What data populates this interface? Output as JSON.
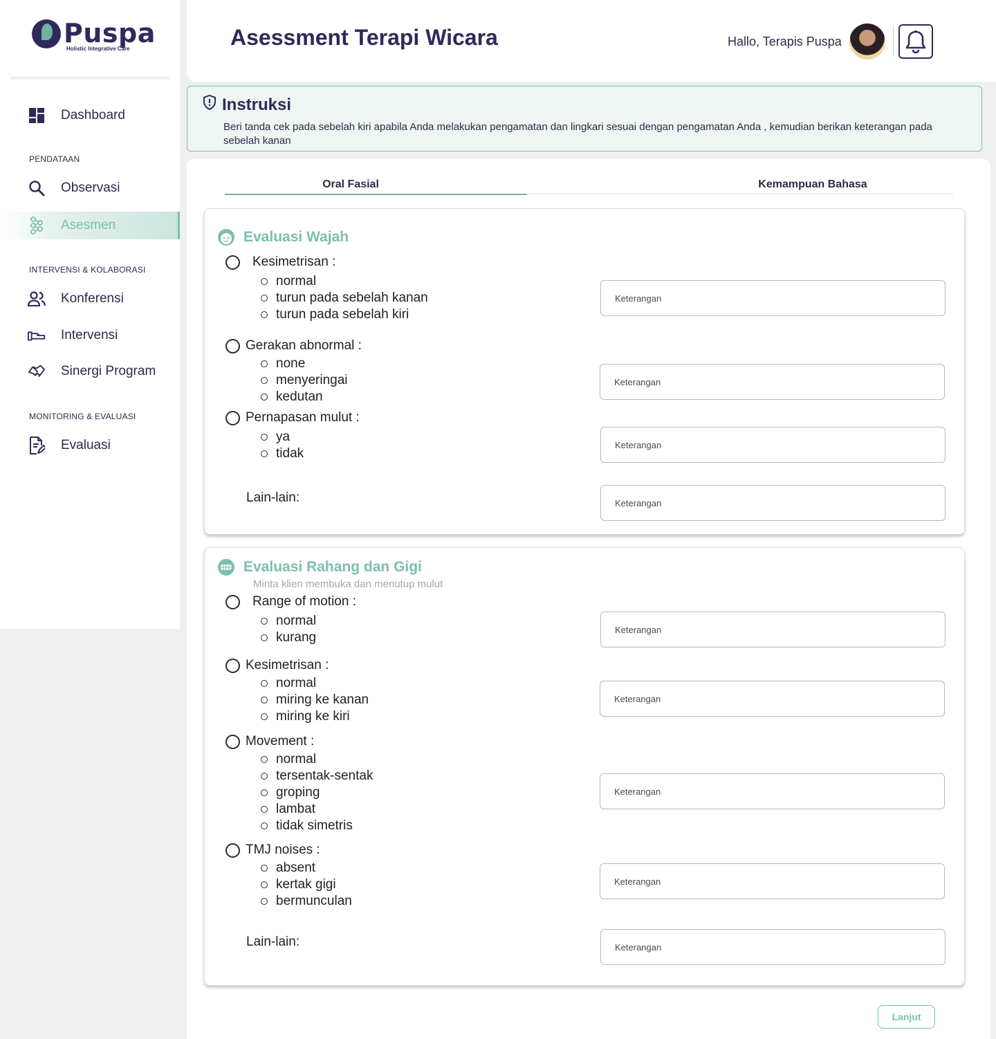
{
  "brand": {
    "name": "Puspa",
    "tagline": "Holistic Integrative Care"
  },
  "sidebar": {
    "dashboard": "Dashboard",
    "sections": {
      "pendataan": "PENDATAAN",
      "intervensi": "INTERVENSI & KOLABORASI",
      "monitoring": "MONITORING & EVALUASI"
    },
    "items": {
      "observasi": "Observasi",
      "asesmen": "Asesmen",
      "konferensi": "Konferensi",
      "intervensi": "Intervensi",
      "sinergi": "Sinergi Program",
      "evaluasi": "Evaluasi"
    },
    "active": "Asesmen"
  },
  "header": {
    "title": "Asessment Terapi Wicara",
    "greeting": "Hallo, Terapis Puspa"
  },
  "instruction": {
    "title": "Instruksi",
    "text": "Beri tanda cek pada sebelah kiri apabila Anda melakukan pengamatan dan lingkari sesuai dengan pengamatan Anda , kemudian berikan keterangan pada sebelah kanan"
  },
  "tabs": {
    "oral": "Oral Fasial",
    "bahasa": "Kemampuan Bahasa",
    "active": "Oral Fasial"
  },
  "wajah": {
    "title": "Evaluasi Wajah",
    "q1": {
      "label": "Kesimetrisan :",
      "options": [
        "normal",
        "turun pada sebelah kanan",
        "turun pada sebelah kiri"
      ]
    },
    "q2": {
      "label": "Gerakan abnormal :",
      "options": [
        "none",
        "menyeringai",
        "kedutan"
      ]
    },
    "q3": {
      "label": "Pernapasan mulut :",
      "options": [
        "ya",
        "tidak"
      ]
    },
    "lain": "Lain-lain:"
  },
  "rahang": {
    "title": "Evaluasi Rahang dan Gigi",
    "subtitle": "Minta klien membuka dan menutup mulut",
    "q1": {
      "label": "Range of motion :",
      "options": [
        "normal",
        "kurang"
      ]
    },
    "q2": {
      "label": "Kesimetrisan :",
      "options": [
        "normal",
        "miring ke kanan",
        "miring ke kiri"
      ]
    },
    "q3": {
      "label": "Movement :",
      "options": [
        "normal",
        "tersentak-sentak",
        "groping",
        "lambat",
        "tidak simetris"
      ]
    },
    "q4": {
      "label": "TMJ noises :",
      "options": [
        "absent",
        "kertak gigi",
        "bermunculan"
      ]
    },
    "lain": "Lain-lain:"
  },
  "keterangan_placeholder": "Keterangan",
  "next_button": "Lanjut",
  "colors": {
    "primary": "#2f2a5c",
    "accent": "#7bbfae",
    "background": "#efefef"
  }
}
